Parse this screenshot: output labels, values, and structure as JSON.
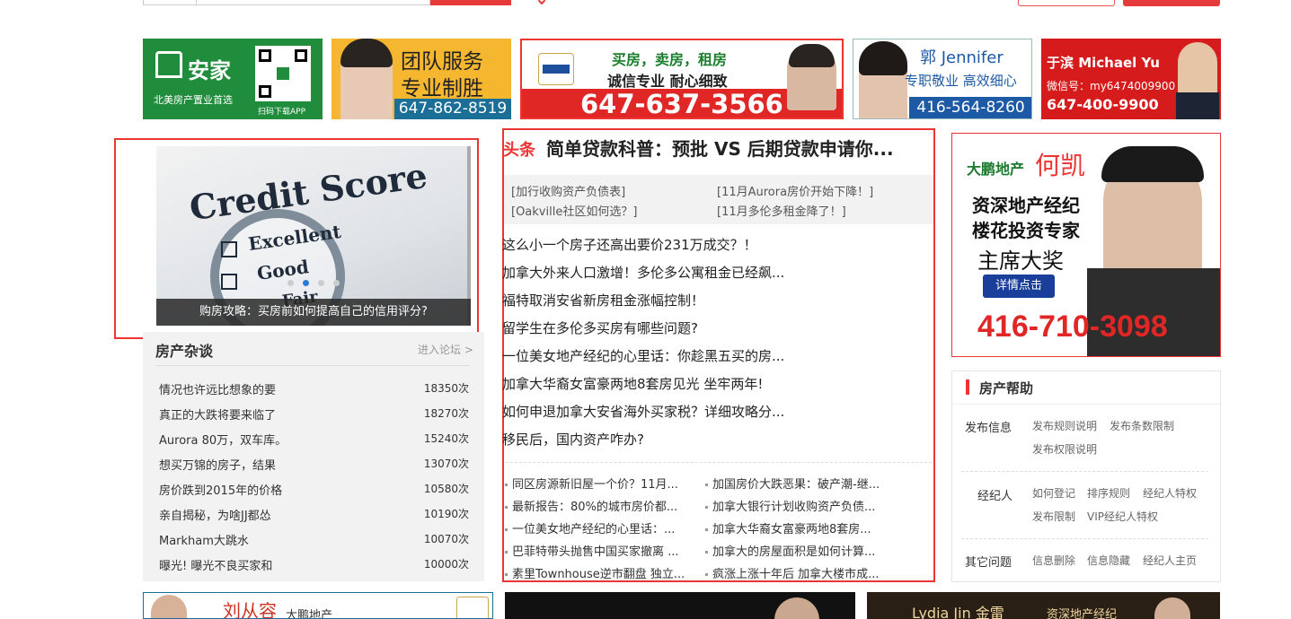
{
  "banners": {
    "anjia": {
      "logo_text": "安家",
      "tagline": "北美房产置业首选",
      "qr_caption": "扫码下载APP"
    },
    "team": {
      "line1": "团队服务",
      "line2": "专业制胜",
      "phone": "647-862-8519"
    },
    "homelife": {
      "slogan1": "买房，卖房，租房",
      "slogan2": "诚信专业  耐心细致",
      "phone": "647-637-3566"
    },
    "jennifer": {
      "name": "郭 Jennifer",
      "slogan": "专职敬业 高效细心",
      "phone": "416-564-8260"
    },
    "michael": {
      "name": "于滨 Michael Yu",
      "wechat": "微信号：my6474009900",
      "phone": "647-400-9900"
    }
  },
  "carousel": {
    "caption": "购房攻略：买房前如何提高自己的信用评分?",
    "image_text1": "Credit Score",
    "image_text2": "Excellent",
    "image_text3": "Good",
    "image_text4": "Fair",
    "active_index": 1
  },
  "forum": {
    "title": "房产杂谈",
    "more": "进入论坛 >",
    "rows": [
      {
        "title": "情况也许远比想象的要",
        "count": "18350次"
      },
      {
        "title": "真正的大跌将要来临了",
        "count": "18270次"
      },
      {
        "title": "Aurora 80万，双车库。",
        "count": "15240次"
      },
      {
        "title": "想买万锦的房子，结果",
        "count": "13070次"
      },
      {
        "title": "房价跌到2015年的价格",
        "count": "10580次"
      },
      {
        "title": "亲自揭秘，为啥JJ都怂",
        "count": "10190次"
      },
      {
        "title": "Markham大跳水",
        "count": "10070次"
      },
      {
        "title": "曝光! 曝光不良买家和",
        "count": "10000次"
      }
    ]
  },
  "headline": {
    "tag": "头条",
    "title": "简单贷款科普：预批 VS 后期贷款申请你...",
    "tags": [
      "[加行收购资产负债表]",
      "[11月Aurora房价开始下降！]",
      "[Oakville社区如何选？]",
      "[11月多伦多租金降了！]"
    ],
    "news": [
      "这么小一个房子还高出要价231万成交？！",
      "加拿大外来人口激增！多伦多公寓租金已经飙...",
      "福特取消安省新房租金涨幅控制！",
      "留学生在多伦多买房有哪些问题?",
      "一位美女地产经纪的心里话：你趁黑五买的房...",
      "加拿大华裔女富豪两地8套房见光 坐牢两年!",
      "如何申退加拿大安省海外买家税？详细攻略分...",
      "移民后，国内资产咋办?"
    ],
    "small_news_left": [
      "同区房源新旧屋一个价？11月...",
      "最新报告：80%的城市房价都...",
      "一位美女地产经纪的心里话：...",
      "巴菲特带头抛售中国买家撤离 ...",
      "素里Townhouse逆市翻盘 独立..."
    ],
    "small_news_right": [
      "加国房价大跌恶果：破产潮-继...",
      "加拿大银行计划收购资产负债...",
      "加拿大华裔女富豪两地8套房...",
      "加拿大的房屋面积是如何计算...",
      "疯涨上涨十年后 加拿大楼市成..."
    ]
  },
  "right_ad": {
    "company": "大鹏地产",
    "name": "何凯",
    "line1": "资深地产经纪",
    "line2": "楼花投资专家",
    "line3": "主席大奖",
    "button": "详情点击",
    "phone": "416-710-3098"
  },
  "help": {
    "title": "房产帮助",
    "sections": [
      {
        "cat": "发布信息",
        "links": [
          "发布规则说明",
          "发布条数限制",
          "发布权限说明"
        ]
      },
      {
        "cat": "经纪人",
        "links": [
          "如何登记",
          "排序规则",
          "经纪人特权",
          "发布限制",
          "VIP经纪人特权"
        ]
      },
      {
        "cat": "其它问题",
        "links": [
          "信息删除",
          "信息隐藏",
          "经纪人主页"
        ]
      }
    ]
  },
  "bottom": {
    "name1": "刘从容",
    "company1": "大鹏地产",
    "name3": "Lydia Jin 金雷",
    "slogan3": "资深地产经纪"
  }
}
